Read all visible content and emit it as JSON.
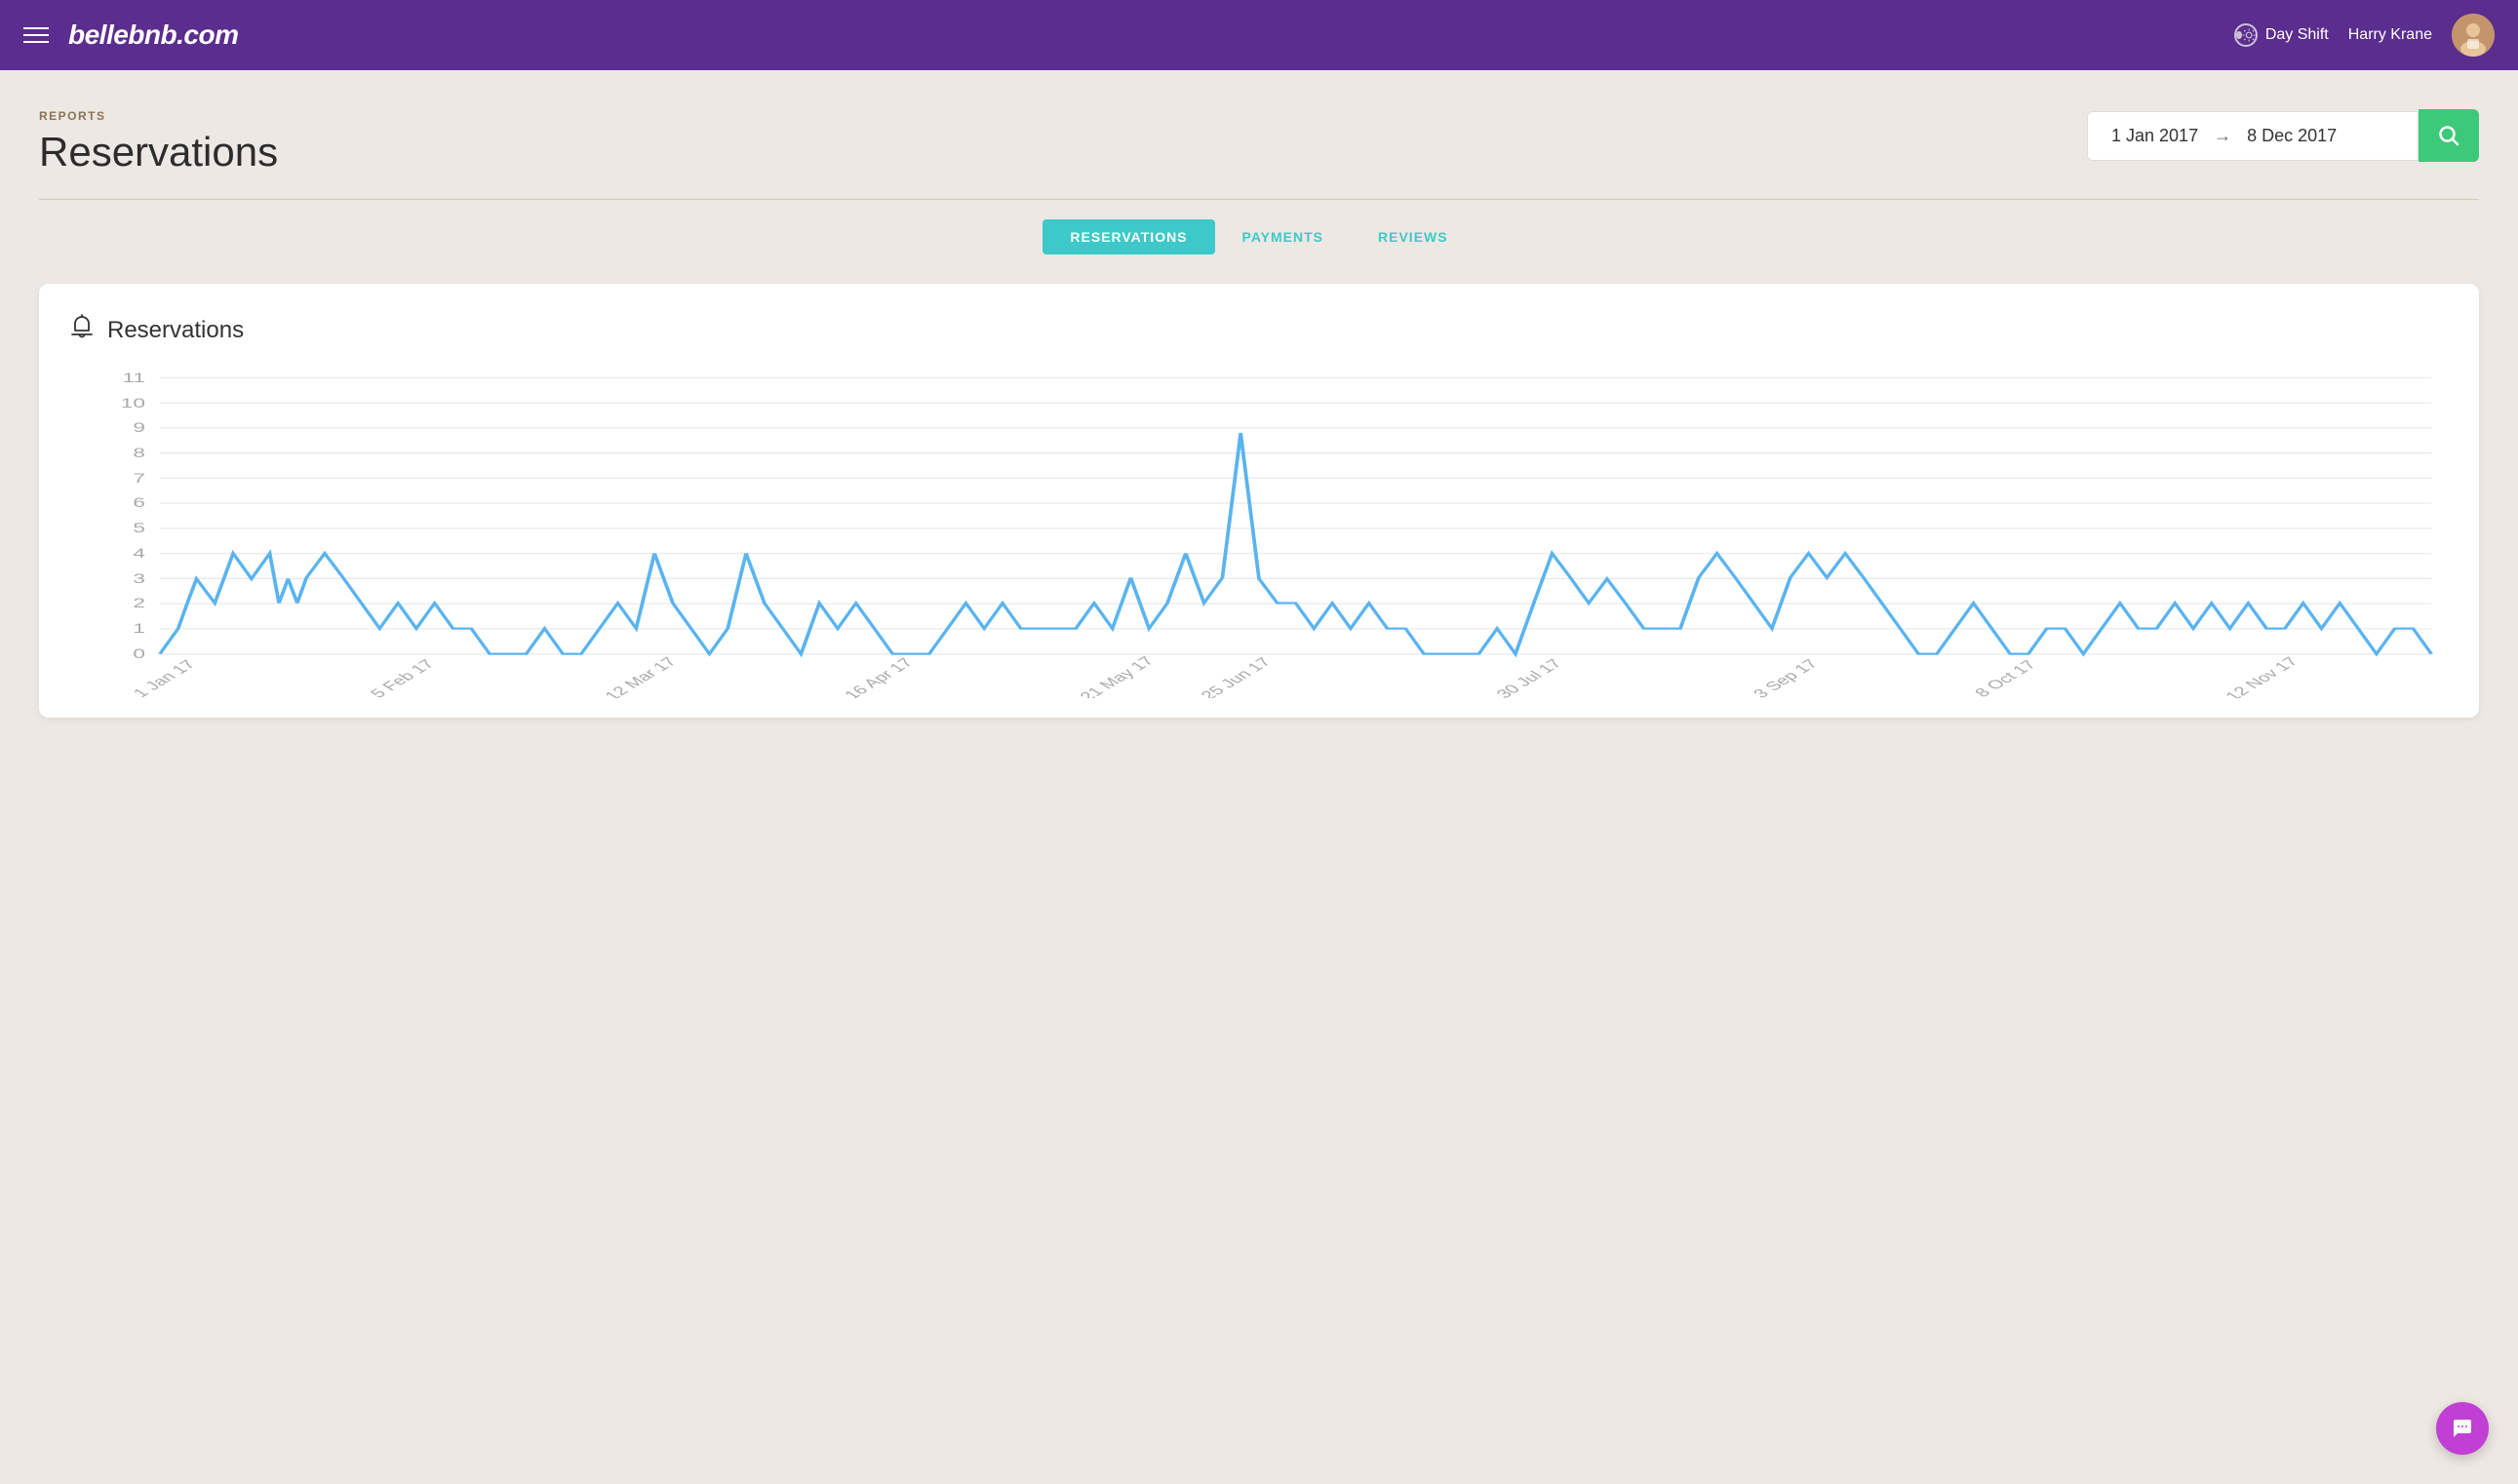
{
  "header": {
    "logo": "bellebnb.com",
    "day_shift_label": "Day Shift",
    "user_name": "Harry Krane"
  },
  "breadcrumb": "REPORTS",
  "page_title": "Reservations",
  "date_range": {
    "start": "1 Jan 2017",
    "end": "8 Dec 2017",
    "arrow": "→"
  },
  "search_button_label": "Search",
  "tabs": [
    {
      "id": "reservations",
      "label": "RESERVATIONS",
      "active": true
    },
    {
      "id": "payments",
      "label": "PAYMENTS",
      "active": false
    },
    {
      "id": "reviews",
      "label": "REVIEWS",
      "active": false
    }
  ],
  "chart": {
    "title": "Reservations",
    "y_axis": [
      11,
      10,
      9,
      8,
      7,
      6,
      5,
      4,
      3,
      2,
      1,
      0
    ],
    "x_labels": [
      "1 Jan 17",
      "5 Feb 17",
      "12 Mar 17",
      "16 Apr 17",
      "21 May 17",
      "25 Jun 17",
      "30 Jul 17",
      "3 Sep 17",
      "8 Oct 17",
      "12 Nov 17"
    ]
  }
}
